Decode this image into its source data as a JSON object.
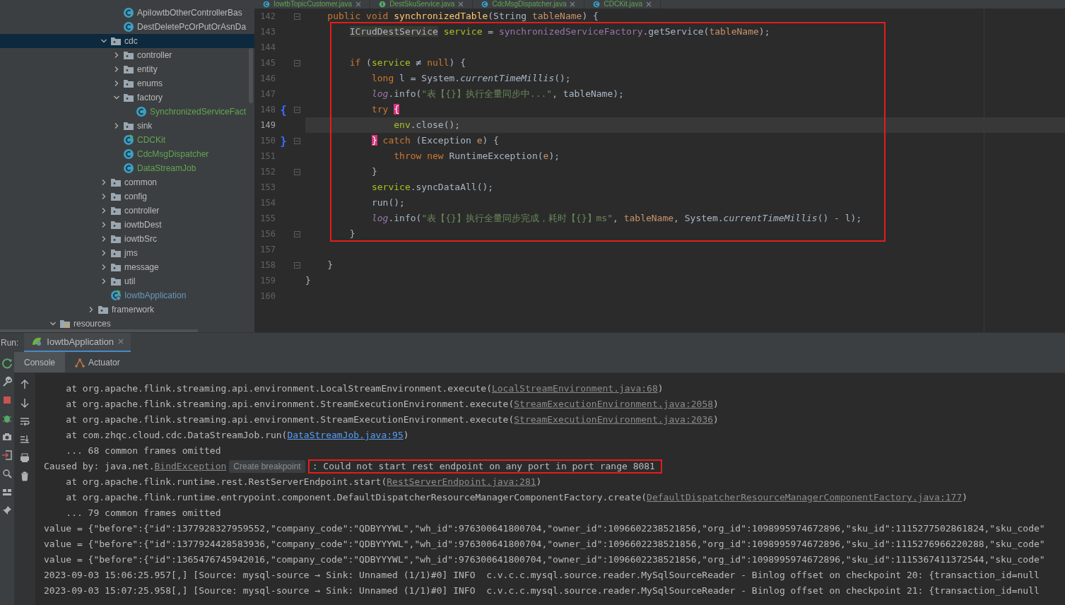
{
  "project_tree": {
    "items": [
      {
        "children": [
          {
            "children": [
              {
                "children": [
                  {
                    "children": [
                      {
                        "children": [
                          {
                            "label": "ApiIowtbOtherControllerBas",
                            "kind": "class",
                            "color": "#bbbbbb",
                            "selected": false
                          },
                          {
                            "label": "DestDeletePcOrPutOrAsnDa",
                            "kind": "class",
                            "color": "#bbbbbb",
                            "selected": false
                          }
                        ]
                      },
                      {
                        "label": "cdc",
                        "kind": "folder",
                        "expanded": true,
                        "selected": true,
                        "children": [
                          {
                            "label": "controller",
                            "kind": "folder",
                            "expanded": false,
                            "selected": false
                          },
                          {
                            "label": "entity",
                            "kind": "folder",
                            "expanded": false,
                            "selected": false
                          },
                          {
                            "label": "enums",
                            "kind": "folder",
                            "expanded": false,
                            "selected": false
                          },
                          {
                            "label": "factory",
                            "kind": "folder",
                            "expanded": true,
                            "selected": false,
                            "children": [
                              {
                                "label": "SynchronizedServiceFact",
                                "kind": "class",
                                "color": "#62a552",
                                "selected": false
                              }
                            ]
                          },
                          {
                            "label": "sink",
                            "kind": "folder",
                            "expanded": false,
                            "selected": false
                          },
                          {
                            "label": "CDCKit",
                            "kind": "runnable",
                            "color": "#62a552",
                            "selected": false
                          },
                          {
                            "label": "CdcMsgDispatcher",
                            "kind": "class",
                            "color": "#62a552",
                            "selected": false
                          },
                          {
                            "label": "DataStreamJob",
                            "kind": "class",
                            "color": "#62a552",
                            "selected": false
                          }
                        ]
                      },
                      {
                        "label": "common",
                        "kind": "folder",
                        "expanded": false,
                        "selected": false
                      },
                      {
                        "label": "config",
                        "kind": "folder",
                        "expanded": false,
                        "selected": false
                      },
                      {
                        "label": "controller",
                        "kind": "folder",
                        "expanded": false,
                        "selected": false
                      },
                      {
                        "label": "iowtbDest",
                        "kind": "folder",
                        "expanded": false,
                        "selected": false
                      },
                      {
                        "label": "iowtbSrc",
                        "kind": "folder",
                        "expanded": false,
                        "selected": false
                      },
                      {
                        "label": "jms",
                        "kind": "folder",
                        "expanded": false,
                        "selected": false
                      },
                      {
                        "label": "message",
                        "kind": "folder",
                        "expanded": false,
                        "selected": false
                      },
                      {
                        "label": "util",
                        "kind": "folder",
                        "expanded": false,
                        "selected": false
                      },
                      {
                        "label": "IowtbApplication",
                        "kind": "app",
                        "color": "#6897bb",
                        "selected": false
                      }
                    ]
                  },
                  {
                    "label": "framerwork",
                    "kind": "folder",
                    "expanded": false,
                    "selected": false
                  }
                ]
              }
            ]
          }
        ]
      },
      {
        "label": "resources",
        "kind": "resources",
        "expanded": true,
        "selected": false
      }
    ]
  },
  "editor": {
    "tabs": [
      {
        "label": "IowtbTopicCustomer.java",
        "kind": "class",
        "selected": false
      },
      {
        "label": "DestSkuService.java",
        "kind": "interface",
        "selected": false
      },
      {
        "label": "CdcMsgDispatcher.java",
        "kind": "class",
        "selected": false
      },
      {
        "label": "CDCKit.java",
        "kind": "class",
        "selected": false
      }
    ],
    "lines": [
      {
        "number": "142",
        "fold": true,
        "highlighted": false,
        "current": false,
        "tokens": [
          {
            "text": "    public void ",
            "kind": "keyword"
          },
          {
            "text": "synchronizedTable",
            "kind": "method"
          },
          {
            "text": "(String ",
            "kind": "plain"
          },
          {
            "text": "tableName",
            "kind": "param"
          },
          {
            "text": ") {",
            "kind": "plain"
          }
        ]
      },
      {
        "number": "143",
        "fold": false,
        "highlighted": true,
        "current": false,
        "tokens": [
          {
            "text": "        ICrudDestService",
            "kind": "usage"
          },
          {
            "text": " service",
            "kind": "local"
          },
          {
            "text": " = ",
            "kind": "plain"
          },
          {
            "text": "synchronizedServiceFactory",
            "kind": "field"
          },
          {
            "text": ".getService(",
            "kind": "plain"
          },
          {
            "text": "tableName",
            "kind": "param"
          },
          {
            "text": ");",
            "kind": "plain"
          }
        ]
      },
      {
        "number": "144",
        "fold": false,
        "highlighted": true,
        "current": false
      },
      {
        "number": "145",
        "fold": true,
        "highlighted": true,
        "current": false,
        "tokens": [
          {
            "text": "        if",
            "kind": "keyword"
          },
          {
            "text": " (",
            "kind": "plain"
          },
          {
            "text": "service",
            "kind": "local"
          },
          {
            "text": " ≠ ",
            "kind": "plain"
          },
          {
            "text": "null",
            "kind": "keyword"
          },
          {
            "text": ") {",
            "kind": "plain"
          }
        ]
      },
      {
        "number": "146",
        "fold": false,
        "highlighted": true,
        "current": false,
        "tokens": [
          {
            "text": "            long",
            "kind": "keyword"
          },
          {
            "text": " l = System.",
            "kind": "plain"
          },
          {
            "text": "currentTimeMillis",
            "kind": "static"
          },
          {
            "text": "();",
            "kind": "plain"
          }
        ]
      },
      {
        "number": "147",
        "fold": false,
        "highlighted": true,
        "current": false,
        "tokens": [
          {
            "text": "            log",
            "kind": "field_italic"
          },
          {
            "text": ".info(",
            "kind": "plain"
          },
          {
            "text": "\"表【{}】执行全量同步中...\"",
            "kind": "string"
          },
          {
            "text": ", tableName);",
            "kind": "plain"
          }
        ]
      },
      {
        "number": "148",
        "fold": true,
        "highlighted": true,
        "current": false,
        "gutter_mark": "{",
        "tokens": [
          {
            "text": "            try ",
            "kind": "keyword"
          },
          {
            "text": "{",
            "kind": "match"
          }
        ]
      },
      {
        "number": "149",
        "fold": false,
        "highlighted": true,
        "current": true,
        "tokens": [
          {
            "text": "                env",
            "kind": "local"
          },
          {
            "text": ".close();",
            "kind": "plain"
          }
        ]
      },
      {
        "number": "150",
        "fold": true,
        "highlighted": true,
        "current": false,
        "gutter_mark": "}",
        "tokens": [
          {
            "text": "            }",
            "kind": "match"
          },
          {
            "text": " catch",
            "kind": "keyword"
          },
          {
            "text": " (Exception ",
            "kind": "plain"
          },
          {
            "text": "e",
            "kind": "param"
          },
          {
            "text": ") {",
            "kind": "plain"
          }
        ]
      },
      {
        "number": "151",
        "fold": false,
        "highlighted": true,
        "current": false,
        "tokens": [
          {
            "text": "                throw new ",
            "kind": "keyword"
          },
          {
            "text": "RuntimeException(",
            "kind": "plain"
          },
          {
            "text": "e",
            "kind": "param"
          },
          {
            "text": ");",
            "kind": "plain"
          }
        ]
      },
      {
        "number": "152",
        "fold": true,
        "highlighted": true,
        "current": false,
        "tokens": [
          {
            "text": "            }",
            "kind": "plain"
          }
        ]
      },
      {
        "number": "153",
        "fold": false,
        "highlighted": true,
        "current": false,
        "tokens": [
          {
            "text": "            service",
            "kind": "local"
          },
          {
            "text": ".syncDataAll();",
            "kind": "plain"
          }
        ]
      },
      {
        "number": "154",
        "fold": false,
        "highlighted": true,
        "current": false,
        "tokens": [
          {
            "text": "            run();",
            "kind": "plain"
          }
        ]
      },
      {
        "number": "155",
        "fold": false,
        "highlighted": true,
        "current": false,
        "tokens": [
          {
            "text": "            log",
            "kind": "field_italic"
          },
          {
            "text": ".info(",
            "kind": "plain"
          },
          {
            "text": "\"表【{}】执行全量同步完成，耗时【{}】ms\"",
            "kind": "string"
          },
          {
            "text": ", ",
            "kind": "plain"
          },
          {
            "text": "tableName",
            "kind": "param"
          },
          {
            "text": ", System.",
            "kind": "plain"
          },
          {
            "text": "currentTimeMillis",
            "kind": "static"
          },
          {
            "text": "() - l);",
            "kind": "plain"
          }
        ]
      },
      {
        "number": "156",
        "fold": true,
        "highlighted": true,
        "current": false,
        "tokens": [
          {
            "text": "        }",
            "kind": "plain"
          }
        ]
      },
      {
        "number": "157",
        "fold": false,
        "highlighted": false,
        "current": false
      },
      {
        "number": "158",
        "fold": true,
        "highlighted": false,
        "current": false,
        "tokens": [
          {
            "text": "    }",
            "kind": "plain"
          }
        ]
      },
      {
        "number": "159",
        "fold": false,
        "highlighted": false,
        "current": false,
        "tokens": [
          {
            "text": "}",
            "kind": "plain"
          }
        ]
      },
      {
        "number": "160",
        "fold": false,
        "highlighted": false,
        "current": false
      }
    ]
  },
  "run_panel": {
    "label": "Run:",
    "tabs": [
      {
        "label": "IowtbApplication",
        "selected": true
      }
    ],
    "console_tabs": [
      {
        "label": "Console",
        "kind": "plain",
        "selected": true
      },
      {
        "label": "Actuator",
        "kind": "actuator",
        "selected": false
      }
    ],
    "lines": [
      [
        {
          "text": "    at org.apache.flink.streaming.api.environment.LocalStreamEnvironment.execute(",
          "kind": "plain"
        },
        {
          "text": "LocalStreamEnvironment.java:68",
          "kind": "link"
        },
        {
          "text": ")",
          "kind": "plain"
        }
      ],
      [
        {
          "text": "    at org.apache.flink.streaming.api.environment.StreamExecutionEnvironment.execute(",
          "kind": "plain"
        },
        {
          "text": "StreamExecutionEnvironment.java:2058",
          "kind": "link"
        },
        {
          "text": ")",
          "kind": "plain"
        }
      ],
      [
        {
          "text": "    at org.apache.flink.streaming.api.environment.StreamExecutionEnvironment.execute(",
          "kind": "plain"
        },
        {
          "text": "StreamExecutionEnvironment.java:2036",
          "kind": "link"
        },
        {
          "text": ")",
          "kind": "plain"
        }
      ],
      [
        {
          "text": "    at com.zhqc.cloud.cdc.DataStreamJob.run(",
          "kind": "plain"
        },
        {
          "text": "DataStreamJob.java:95",
          "kind": "own_link"
        },
        {
          "text": ")",
          "kind": "plain"
        }
      ],
      [
        {
          "text": "    ... 68 common frames omitted",
          "kind": "plain"
        }
      ],
      [
        {
          "text": "Caused by: java.net.",
          "kind": "plain"
        },
        {
          "text": "BindException",
          "kind": "link"
        },
        {
          "text": "Create breakpoint",
          "kind": "hint"
        },
        {
          "text": ": Could not start rest endpoint on any port in port range 8081",
          "kind": "plain",
          "highlighted": true
        }
      ],
      [
        {
          "text": "    at org.apache.flink.runtime.rest.RestServerEndpoint.start(",
          "kind": "plain"
        },
        {
          "text": "RestServerEndpoint.java:281",
          "kind": "link"
        },
        {
          "text": ")",
          "kind": "plain"
        }
      ],
      [
        {
          "text": "    at org.apache.flink.runtime.entrypoint.component.DefaultDispatcherResourceManagerComponentFactory.create(",
          "kind": "plain"
        },
        {
          "text": "DefaultDispatcherResourceManagerComponentFactory.java:177",
          "kind": "link"
        },
        {
          "text": ")",
          "kind": "plain"
        }
      ],
      [
        {
          "text": "    ... 79 common frames omitted",
          "kind": "plain"
        }
      ],
      [
        {
          "text": "value = {\"before\":{\"id\":1377928327959552,\"company_code\":\"QDBYYYWL\",\"wh_id\":976300641800704,\"owner_id\":1096602238521856,\"org_id\":1098995974672896,\"sku_id\":1115277502861824,\"sku_code\"",
          "kind": "plain"
        }
      ],
      [
        {
          "text": "value = {\"before\":{\"id\":1377924428583936,\"company_code\":\"QDBYYYWL\",\"wh_id\":976300641800704,\"owner_id\":1096602238521856,\"org_id\":1098995974672896,\"sku_id\":1115276966220288,\"sku_code\"",
          "kind": "plain"
        }
      ],
      [
        {
          "text": "value = {\"before\":{\"id\":1365476745942016,\"company_code\":\"QDBYYYWL\",\"wh_id\":976300641800704,\"owner_id\":1096602238521856,\"org_id\":1098995974672896,\"sku_id\":1115367411372544,\"sku_code\"",
          "kind": "plain"
        }
      ],
      [
        {
          "text": "2023-09-03 15:06:25.957[,] [Source: mysql-source → Sink: Unnamed (1/1)#0] INFO  c.v.c.c.mysql.source.reader.MySqlSourceReader - Binlog offset on checkpoint 20: {transaction_id=null",
          "kind": "plain"
        }
      ],
      [
        {
          "text": "2023-09-03 15:07:25.958[,] [Source: mysql-source → Sink: Unnamed (1/1)#0] INFO  c.v.c.c.mysql.source.reader.MySqlSourceReader - Binlog offset on checkpoint 21: {transaction_id=null",
          "kind": "plain"
        }
      ]
    ]
  }
}
